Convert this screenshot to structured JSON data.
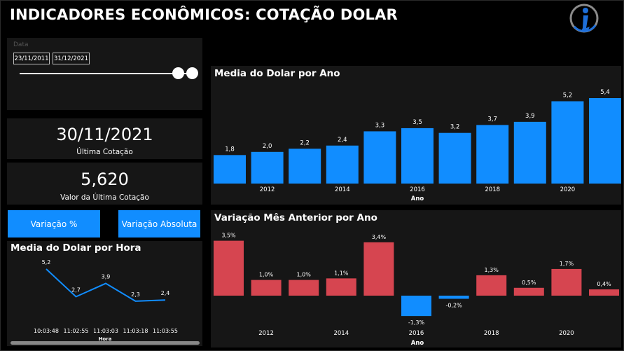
{
  "header": {
    "title": "INDICADORES ECONÔMICOS: COTAÇÃO DOLAR",
    "logo_letter": "i",
    "colors": {
      "accent": "#118dff",
      "negative": "#d64550"
    }
  },
  "slicer": {
    "label": "Data",
    "start": "23/11/2011",
    "end": "31/12/2021"
  },
  "kpis": {
    "last_date": {
      "value": "30/11/2021",
      "label": "Última Cotação"
    },
    "last_value": {
      "value": "5,620",
      "label": "Valor da Última Cotação"
    }
  },
  "buttons": {
    "pct": "Variação %",
    "abs": "Variação Absoluta"
  },
  "chart_data": [
    {
      "id": "yearly",
      "type": "bar",
      "title": "Media do Dolar por Ano",
      "xlabel": "Ano",
      "categories": [
        2011,
        2012,
        2013,
        2014,
        2015,
        2016,
        2017,
        2018,
        2019,
        2020,
        2021
      ],
      "values": [
        1.8,
        2.0,
        2.2,
        2.4,
        3.3,
        3.5,
        3.2,
        3.7,
        3.9,
        5.2,
        5.4
      ],
      "labels": [
        "1,8",
        "2,0",
        "2,2",
        "2,4",
        "3,3",
        "3,5",
        "3,2",
        "3,7",
        "3,9",
        "5,2",
        "5,4"
      ],
      "ticks": [
        "2012",
        "2014",
        "2016",
        "2018",
        "2020"
      ],
      "ylim": [
        0,
        5.4
      ],
      "color": "#118dff"
    },
    {
      "id": "variation",
      "type": "bar",
      "title": "Variação Mês Anterior por Ano",
      "xlabel": "Ano",
      "categories": [
        2011,
        2012,
        2013,
        2014,
        2015,
        2016,
        2017,
        2018,
        2019,
        2020,
        2021
      ],
      "values": [
        3.5,
        1.0,
        1.0,
        1.1,
        3.4,
        -1.3,
        -0.2,
        1.3,
        0.5,
        1.7,
        0.4
      ],
      "labels": [
        "3,5%",
        "1,0%",
        "1,0%",
        "1,1%",
        "3,4%",
        "-1,3%",
        "-0,2%",
        "1,3%",
        "0,5%",
        "1,7%",
        "0,4%"
      ],
      "ticks": [
        "2012",
        "2014",
        "2016",
        "2018",
        "2020"
      ],
      "positive_color": "#d64550",
      "negative_color": "#118dff"
    },
    {
      "id": "hourly",
      "type": "line",
      "title": "Media do Dolar por Hora",
      "xlabel": "Hora",
      "x": [
        "10:03:48",
        "11:02:55",
        "11:03:03",
        "11:03:18",
        "11:03:55"
      ],
      "values": [
        5.2,
        2.7,
        3.9,
        2.3,
        2.4
      ],
      "labels": [
        "5,2",
        "2,7",
        "3,9",
        "2,3",
        "2,4"
      ],
      "color": "#118dff"
    }
  ]
}
